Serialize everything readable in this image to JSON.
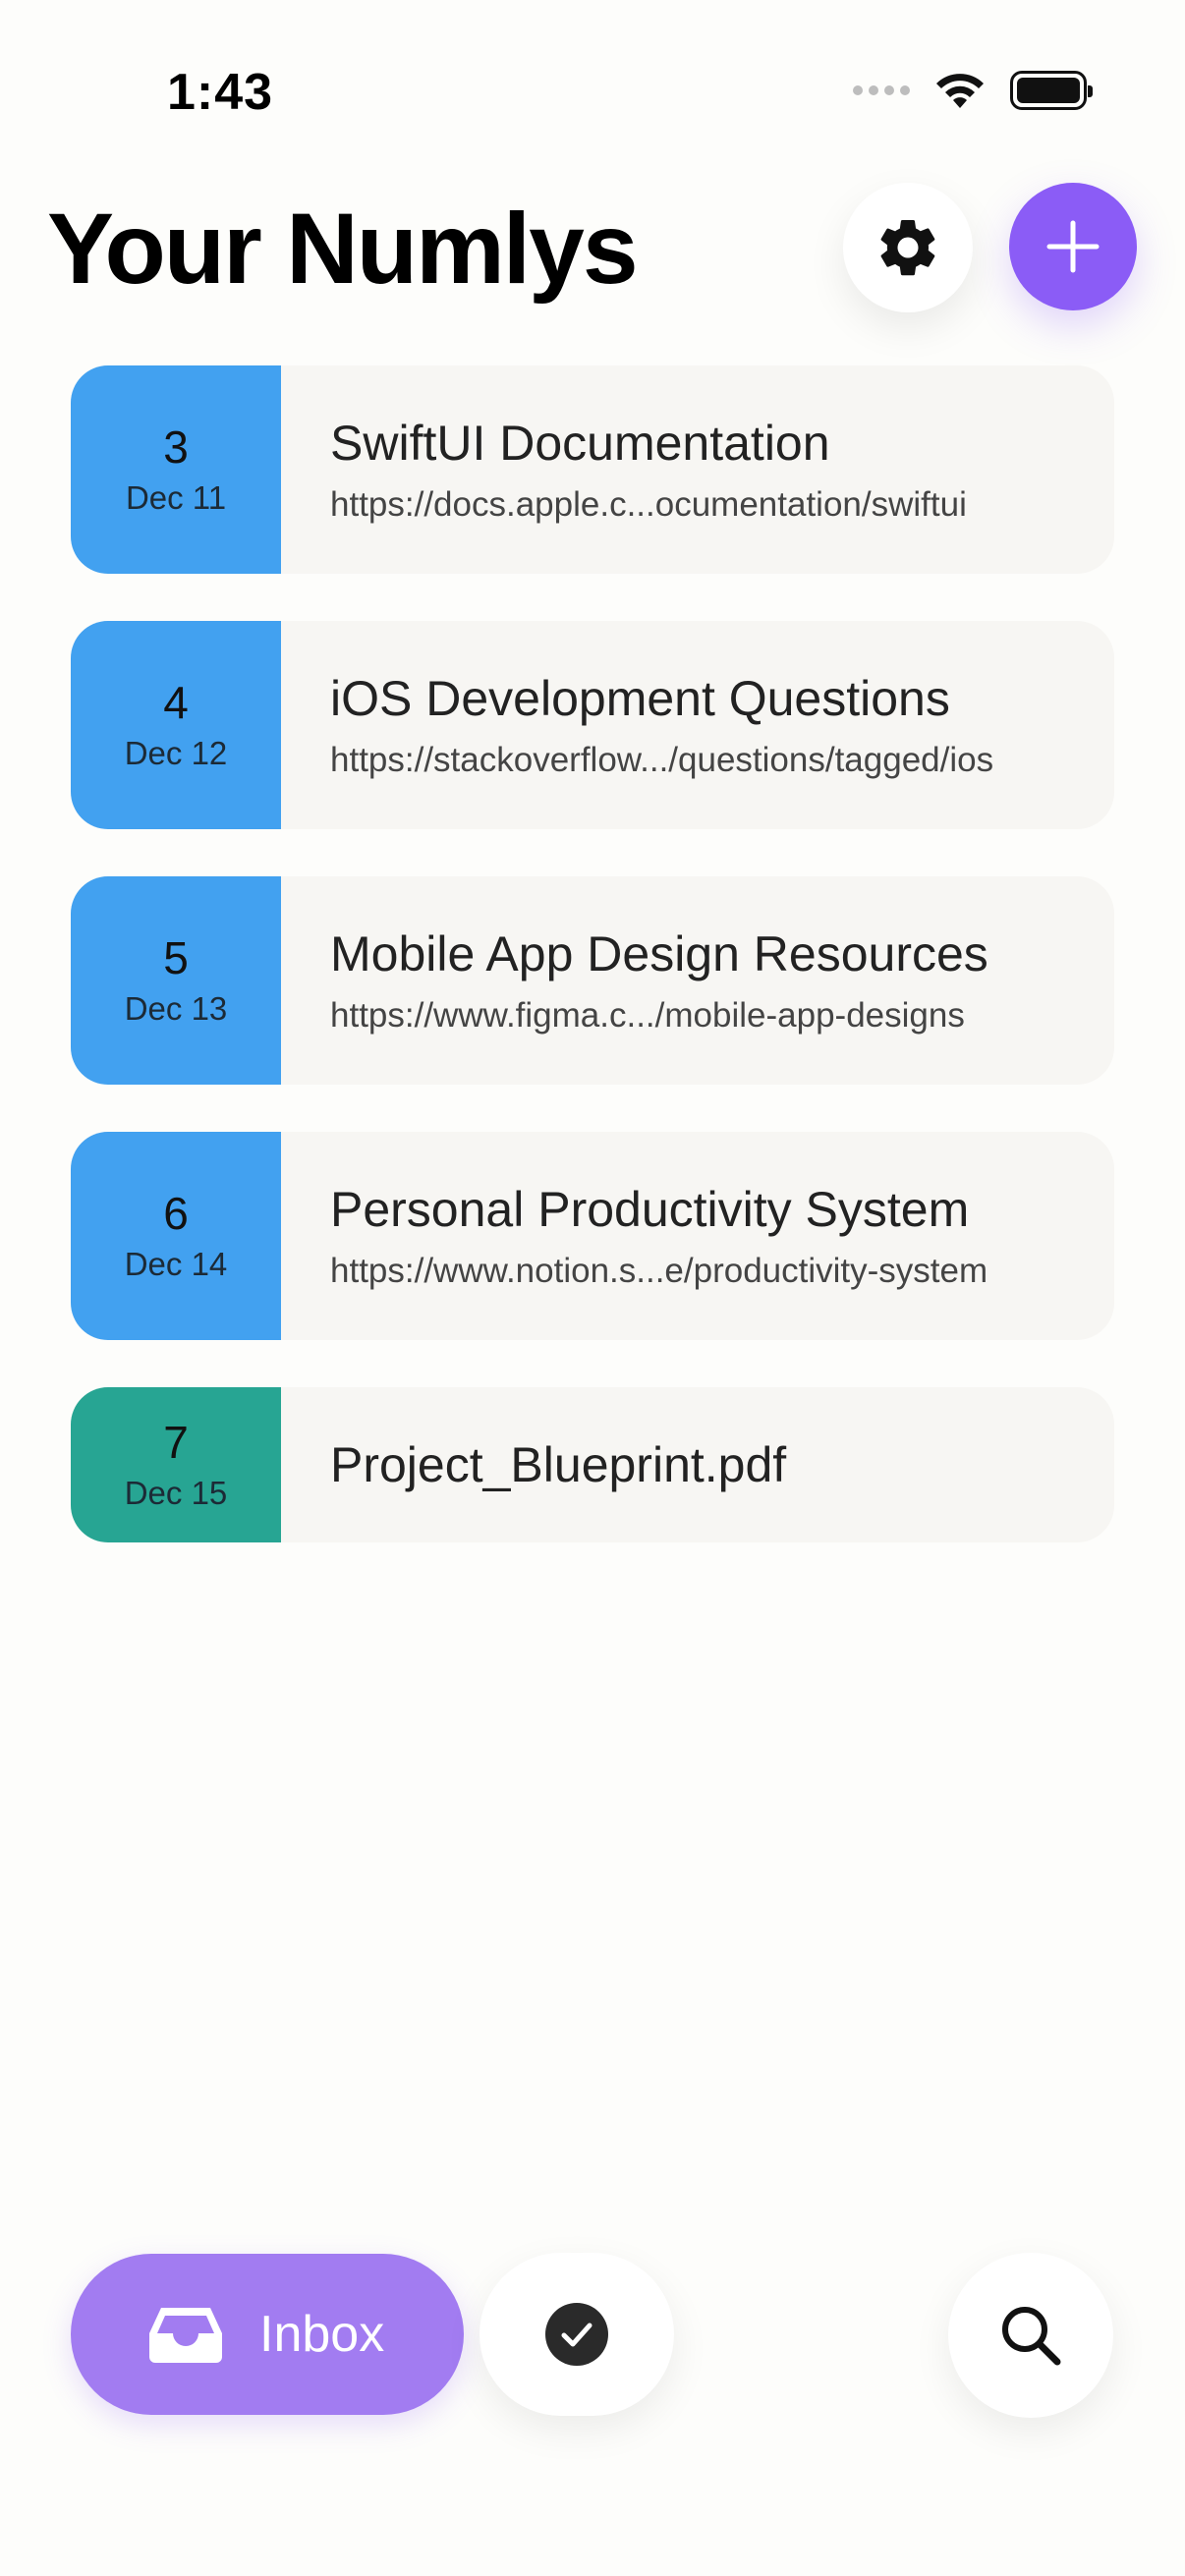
{
  "status_bar": {
    "time": "1:43"
  },
  "header": {
    "title": "Your Numlys"
  },
  "colors": {
    "accent": "#8B5CF6",
    "link_badge": "#42A1F0",
    "file_badge": "#27A593",
    "inbox_tab": "#A27CF1"
  },
  "items": [
    {
      "number": "3",
      "date": "Dec 11",
      "title": "SwiftUI Documentation",
      "url": "https://docs.apple.c...ocumentation/swiftui",
      "kind": "link"
    },
    {
      "number": "4",
      "date": "Dec 12",
      "title": "iOS Development Questions",
      "url": "https://stackoverflow.../questions/tagged/ios",
      "kind": "link"
    },
    {
      "number": "5",
      "date": "Dec 13",
      "title": "Mobile App Design Resources",
      "url": "https://www.figma.c.../mobile-app-designs",
      "kind": "link"
    },
    {
      "number": "6",
      "date": "Dec 14",
      "title": "Personal Productivity System",
      "url": "https://www.notion.s...e/productivity-system",
      "kind": "link"
    },
    {
      "number": "7",
      "date": "Dec 15",
      "title": "Project_Blueprint.pdf",
      "kind": "file"
    }
  ],
  "tabbar": {
    "inbox_label": "Inbox",
    "icons": [
      "tray-icon",
      "checkmark-circle-icon",
      "magnifying-glass-icon"
    ]
  }
}
